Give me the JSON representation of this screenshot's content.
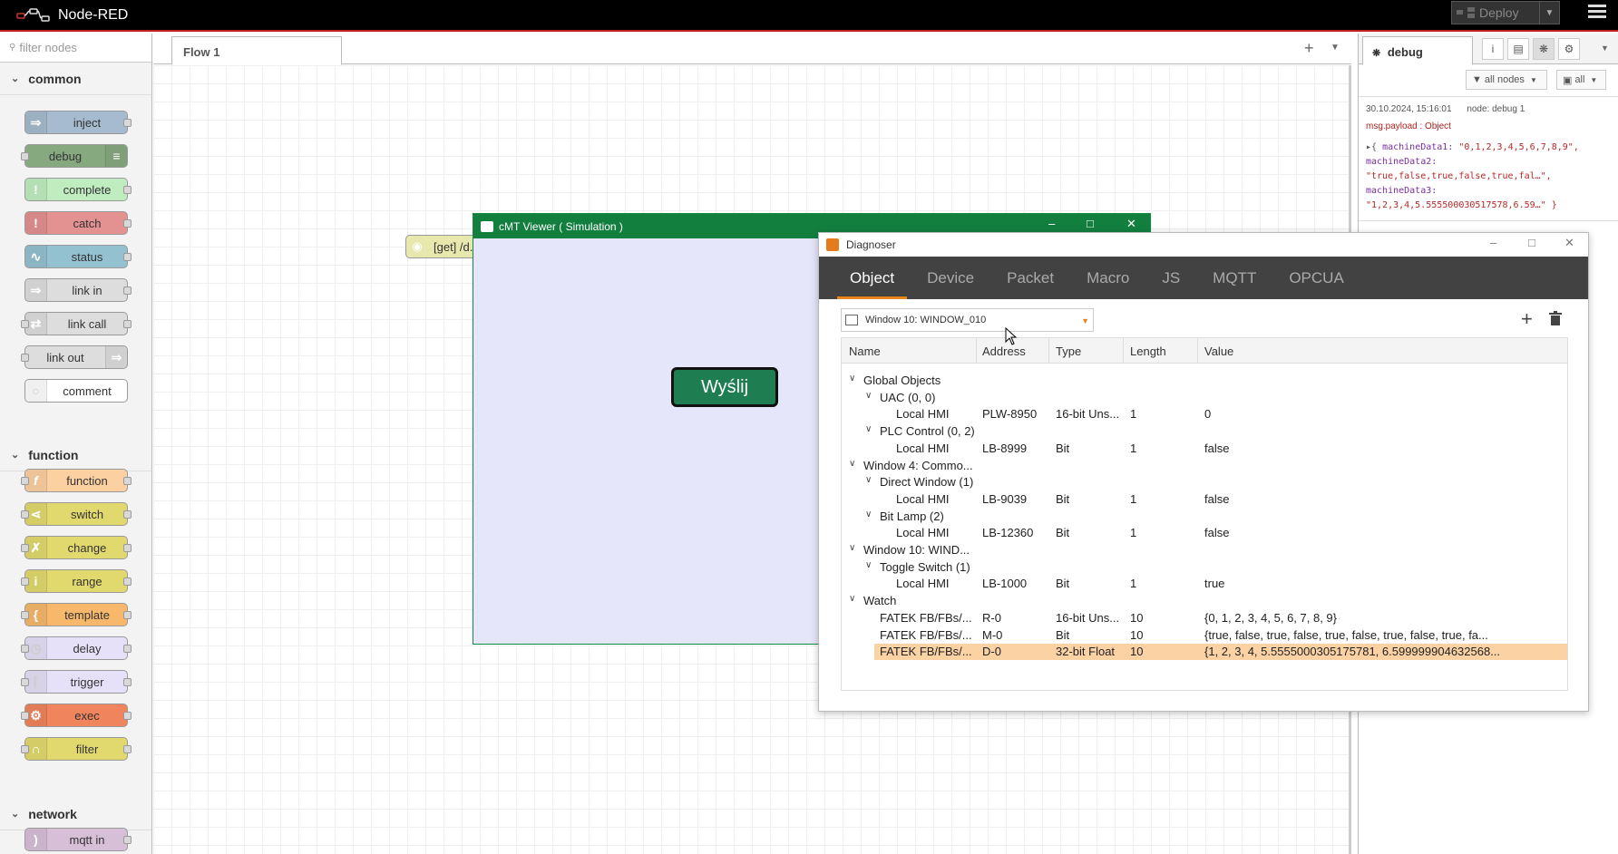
{
  "header": {
    "app_title": "Node-RED",
    "deploy_label": "Deploy"
  },
  "palette": {
    "search_placeholder": "filter nodes",
    "categories": [
      {
        "label": "common",
        "nodes": [
          "inject",
          "debug",
          "complete",
          "catch",
          "status",
          "link in",
          "link call",
          "link out",
          "comment"
        ]
      },
      {
        "label": "function",
        "nodes": [
          "function",
          "switch",
          "change",
          "range",
          "template",
          "delay",
          "trigger",
          "exec",
          "filter"
        ]
      },
      {
        "label": "network",
        "nodes": [
          "mqtt in"
        ]
      }
    ]
  },
  "workspace": {
    "tab_label": "Flow 1",
    "flow_nodes": [
      {
        "label": "[get] /d..."
      }
    ]
  },
  "sidebar": {
    "tab_label": "debug",
    "filter_nodes_label": "all nodes",
    "clear_label": "all",
    "message": {
      "timestamp": "30.10.2024, 15:16:01",
      "node": "node: debug 1",
      "topic": "msg.payload : Object",
      "payload_lines": [
        {
          "key": "machineData1:",
          "value": "\"0,1,2,3,4,5,6,7,8,9\","
        },
        {
          "key": "machineData2:",
          "value": ""
        },
        {
          "key": "",
          "value": "\"true,false,true,false,true,fal…\","
        },
        {
          "key": "machineData3:",
          "value": ""
        },
        {
          "key": "",
          "value": "\"1,2,3,4,5.555500030517578,6.59…\" }"
        }
      ]
    }
  },
  "cmt_viewer": {
    "title": "cMT Viewer ( Simulation )",
    "button_label": "Wyślij"
  },
  "diagnoser": {
    "title": "Diagnoser",
    "tabs": [
      "Object",
      "Device",
      "Packet",
      "Macro",
      "JS",
      "MQTT",
      "OPCUA"
    ],
    "active_tab": "Object",
    "window_select": "Window 10: WINDOW_010",
    "columns": [
      "Name",
      "Address",
      "Type",
      "Length",
      "Value"
    ],
    "rows": [
      {
        "level": 0,
        "toggle": "v",
        "name": "Global Objects",
        "address": "",
        "type": "",
        "length": "",
        "value": ""
      },
      {
        "level": 1,
        "toggle": "v",
        "name": "UAC (0, 0)",
        "address": "",
        "type": "",
        "length": "",
        "value": ""
      },
      {
        "level": 2,
        "toggle": "",
        "name": "Local HMI",
        "address": "PLW-8950",
        "type": "16-bit Uns...",
        "length": "1",
        "value": "0"
      },
      {
        "level": 1,
        "toggle": "v",
        "name": "PLC Control (0, 2)",
        "address": "",
        "type": "",
        "length": "",
        "value": ""
      },
      {
        "level": 2,
        "toggle": "",
        "name": "Local HMI",
        "address": "LB-8999",
        "type": "Bit",
        "length": "1",
        "value": "false"
      },
      {
        "level": 0,
        "toggle": "v",
        "name": "Window 4: Commo...",
        "address": "",
        "type": "",
        "length": "",
        "value": ""
      },
      {
        "level": 1,
        "toggle": "v",
        "name": "Direct Window (1)",
        "address": "",
        "type": "",
        "length": "",
        "value": ""
      },
      {
        "level": 2,
        "toggle": "",
        "name": "Local HMI",
        "address": "LB-9039",
        "type": "Bit",
        "length": "1",
        "value": "false"
      },
      {
        "level": 1,
        "toggle": "v",
        "name": "Bit Lamp (2)",
        "address": "",
        "type": "",
        "length": "",
        "value": ""
      },
      {
        "level": 2,
        "toggle": "",
        "name": "Local HMI",
        "address": "LB-12360",
        "type": "Bit",
        "length": "1",
        "value": "false"
      },
      {
        "level": 0,
        "toggle": "v",
        "name": "Window 10: WIND...",
        "address": "",
        "type": "",
        "length": "",
        "value": ""
      },
      {
        "level": 1,
        "toggle": "v",
        "name": "Toggle Switch (1)",
        "address": "",
        "type": "",
        "length": "",
        "value": ""
      },
      {
        "level": 2,
        "toggle": "",
        "name": "Local HMI",
        "address": "LB-1000",
        "type": "Bit",
        "length": "1",
        "value": "true"
      },
      {
        "level": 0,
        "toggle": "v",
        "name": "Watch",
        "address": "",
        "type": "",
        "length": "",
        "value": ""
      },
      {
        "level": 1,
        "toggle": "",
        "name": "FATEK FB/FBs/...",
        "address": "R-0",
        "type": "16-bit Uns...",
        "length": "10",
        "value": "{0, 1, 2, 3, 4, 5, 6, 7, 8, 9}"
      },
      {
        "level": 1,
        "toggle": "",
        "name": "FATEK FB/FBs/...",
        "address": "M-0",
        "type": "Bit",
        "length": "10",
        "value": "{true, false, true, false, true, false, true, false, true, fa..."
      },
      {
        "level": 1,
        "toggle": "",
        "name": "FATEK FB/FBs/...",
        "address": "D-0",
        "type": "32-bit Float",
        "length": "10",
        "value": "{1, 2, 3, 4, 5.5555000305175781, 6.599999904632568...",
        "selected": true
      }
    ]
  },
  "colors": {
    "header_bg": "#000000",
    "cmt_titlebar": "#127f3f",
    "diag_tab_bar": "#424242",
    "diag_accent": "#e8841f",
    "selected_row": "#fbd2a4"
  }
}
